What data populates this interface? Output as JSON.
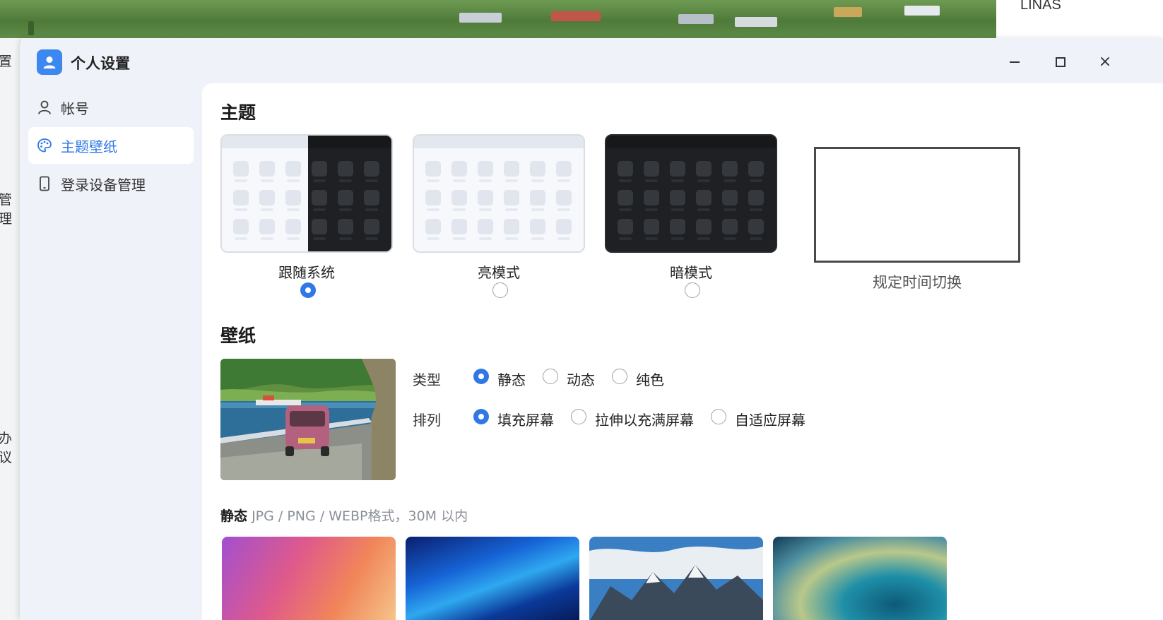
{
  "background_app": {
    "right_text": "LINAS",
    "left_fragments": [
      "置",
      "管理",
      "办议"
    ]
  },
  "window": {
    "title": "个人设置",
    "controls": {
      "minimize": "minimize",
      "maximize": "maximize",
      "close": "×"
    }
  },
  "nav": {
    "items": [
      {
        "label": "帐号",
        "icon": "user-icon",
        "active": false
      },
      {
        "label": "主题壁纸",
        "icon": "palette-icon",
        "active": true
      },
      {
        "label": "登录设备管理",
        "icon": "phone-icon",
        "active": false
      }
    ]
  },
  "theme": {
    "heading": "主题",
    "options": [
      {
        "label": "跟随系统",
        "selected": true
      },
      {
        "label": "亮模式",
        "selected": false
      },
      {
        "label": "暗模式",
        "selected": false
      }
    ],
    "schedule_label": "规定时间切换"
  },
  "wallpaper": {
    "heading": "壁纸",
    "type_label": "类型",
    "type_options": [
      {
        "label": "静态",
        "selected": true
      },
      {
        "label": "动态",
        "selected": false
      },
      {
        "label": "纯色",
        "selected": false
      }
    ],
    "arrange_label": "排列",
    "arrange_options": [
      {
        "label": "填充屏幕",
        "selected": true
      },
      {
        "label": "拉伸以充满屏幕",
        "selected": false
      },
      {
        "label": "自适应屏幕",
        "selected": false
      }
    ],
    "static_title": "静态",
    "static_hint": "JPG / PNG / WEBP格式，30M 以内"
  },
  "colors": {
    "accent": "#2f78e6",
    "window_bg": "#eff2f8",
    "dark_theme": "#1e2023"
  }
}
